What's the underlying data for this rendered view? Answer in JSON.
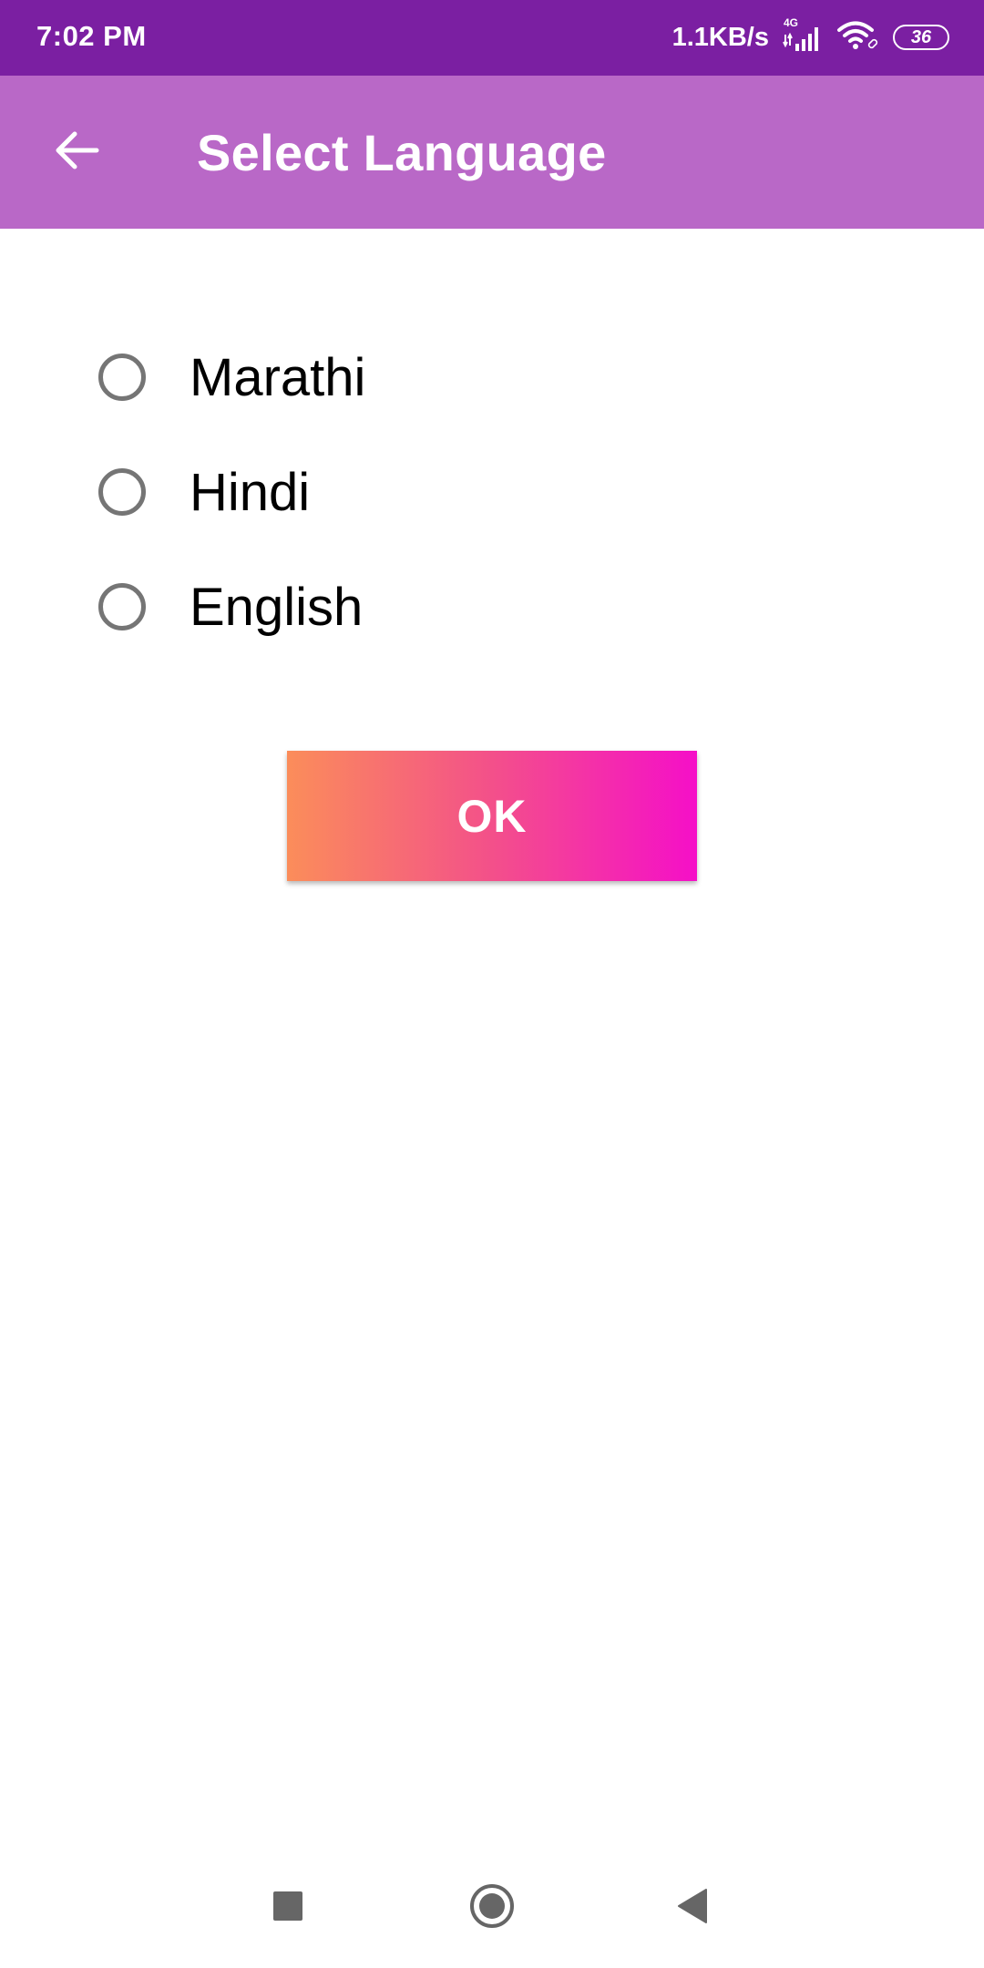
{
  "status_bar": {
    "time": "7:02 PM",
    "network_speed": "1.1KB/s",
    "network_type": "4G",
    "battery_level": "36",
    "icons": [
      "signal-icon",
      "wifi-icon",
      "battery-icon"
    ]
  },
  "app_bar": {
    "title": "Select Language",
    "back_icon": "arrow-back-icon",
    "background_color": "#b968c7"
  },
  "language_options": [
    {
      "label": "Marathi",
      "selected": false
    },
    {
      "label": "Hindi",
      "selected": false
    },
    {
      "label": "English",
      "selected": false
    }
  ],
  "ok_button": {
    "label": "OK",
    "gradient": [
      "#fb8d5a",
      "#f3508a",
      "#f50fc8"
    ]
  },
  "nav_bar": {
    "icons": [
      "recents-square-icon",
      "home-circle-icon",
      "back-triangle-icon"
    ]
  },
  "colors": {
    "status_bar": "#7b1fa2",
    "app_bar": "#b968c7",
    "radio_border": "#757575"
  }
}
